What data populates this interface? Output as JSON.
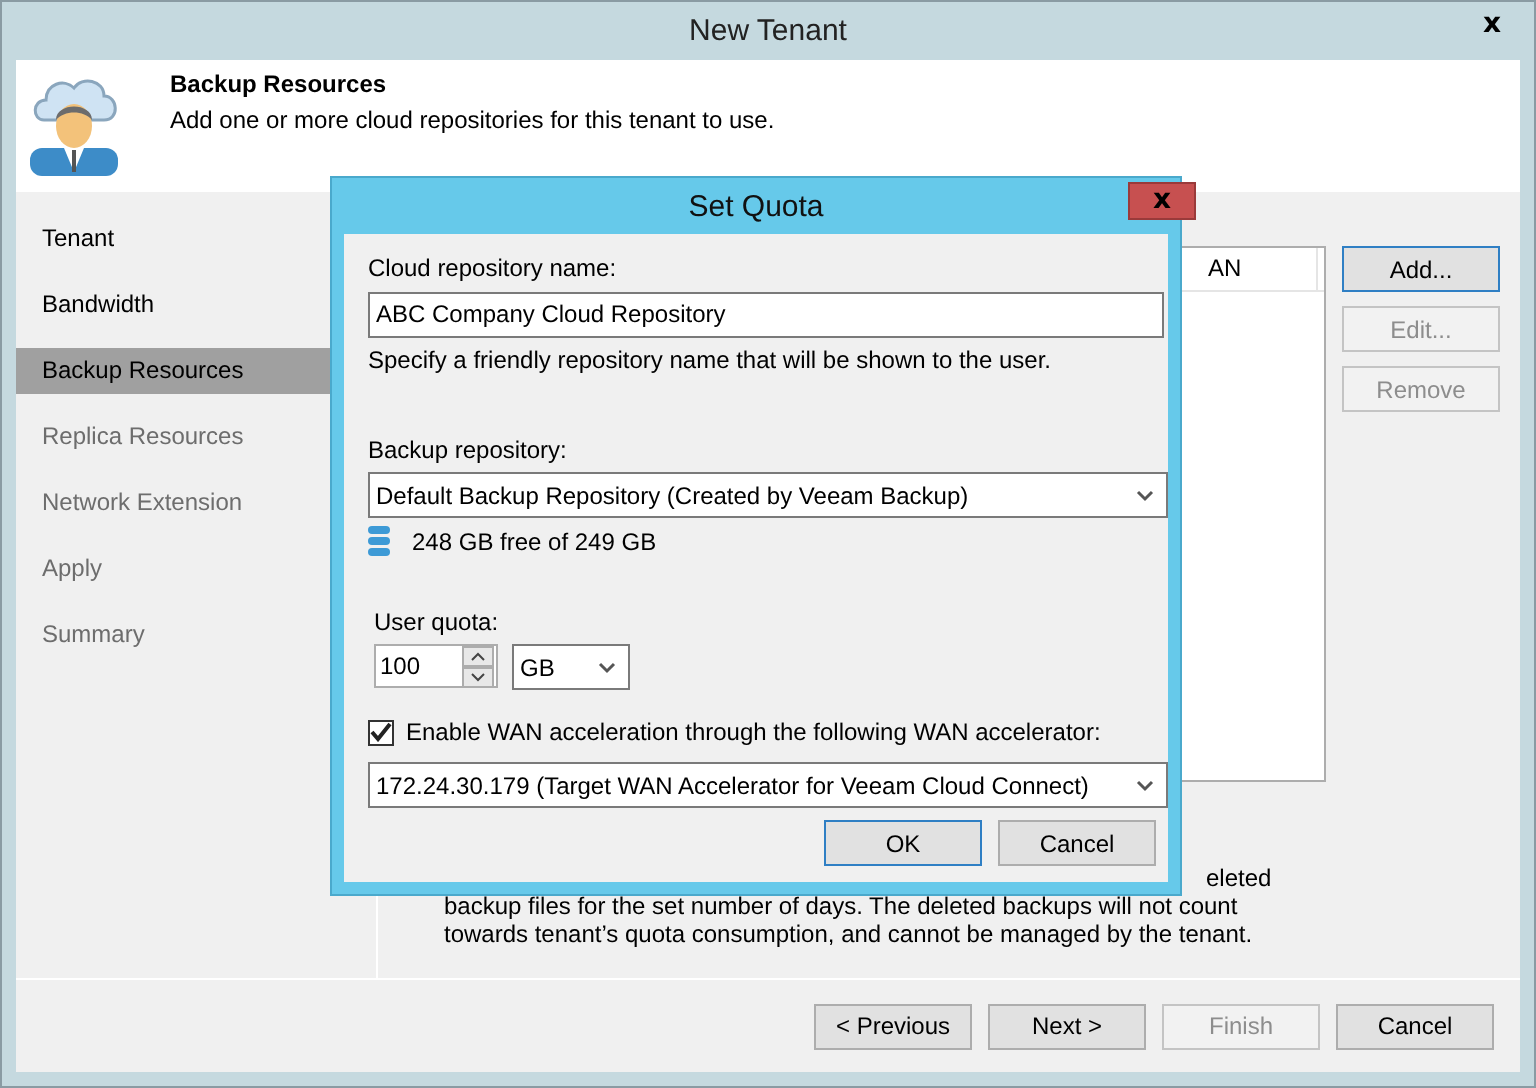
{
  "window": {
    "title": "New Tenant",
    "close": "x"
  },
  "header": {
    "title": "Backup Resources",
    "description": "Add one or more cloud repositories for this tenant to use."
  },
  "steps": [
    {
      "label": "Tenant",
      "selected": false,
      "disabled": false
    },
    {
      "label": "Bandwidth",
      "selected": false,
      "disabled": false
    },
    {
      "label": "Backup Resources",
      "selected": true,
      "disabled": false
    },
    {
      "label": "Replica Resources",
      "selected": false,
      "disabled": true
    },
    {
      "label": "Network Extension",
      "selected": false,
      "disabled": true
    },
    {
      "label": "Apply",
      "selected": false,
      "disabled": true
    },
    {
      "label": "Summary",
      "selected": false,
      "disabled": true
    }
  ],
  "repository_list": {
    "column_3": "AN"
  },
  "side_buttons": [
    {
      "label": "Add...",
      "disabled": false,
      "default": true
    },
    {
      "label": "Edit...",
      "disabled": true,
      "default": false
    },
    {
      "label": "Remove",
      "disabled": true,
      "default": false
    }
  ],
  "note_lines": [
    "eleted",
    "backup files for the set number of days. The deleted backups will not count",
    "towards tenant’s quota consumption, and cannot be managed by the tenant."
  ],
  "footer_buttons": [
    {
      "label": "< Previous",
      "disabled": false
    },
    {
      "label": "Next >",
      "disabled": false
    },
    {
      "label": "Finish",
      "disabled": true
    },
    {
      "label": "Cancel",
      "disabled": false
    }
  ],
  "dialog": {
    "title": "Set Quota",
    "close": "x",
    "name_label": "Cloud repository name:",
    "name_value": "ABC Company Cloud Repository",
    "name_hint": "Specify a friendly repository name that will be shown to the user.",
    "repository_label": "Backup repository:",
    "repository_value": "Default Backup Repository (Created by Veeam Backup)",
    "free_space": "248 GB free of 249 GB",
    "quota_label": "User quota:",
    "quota_value": "100",
    "quota_unit": "GB",
    "wan": {
      "label": "Enable WAN acceleration through the following WAN accelerator:",
      "checked": true
    },
    "wan_accelerator": "172.24.30.179 (Target WAN Accelerator for Veeam Cloud Connect)",
    "buttons": [
      {
        "label": "OK",
        "default": true
      },
      {
        "label": "Cancel",
        "default": false
      }
    ]
  }
}
